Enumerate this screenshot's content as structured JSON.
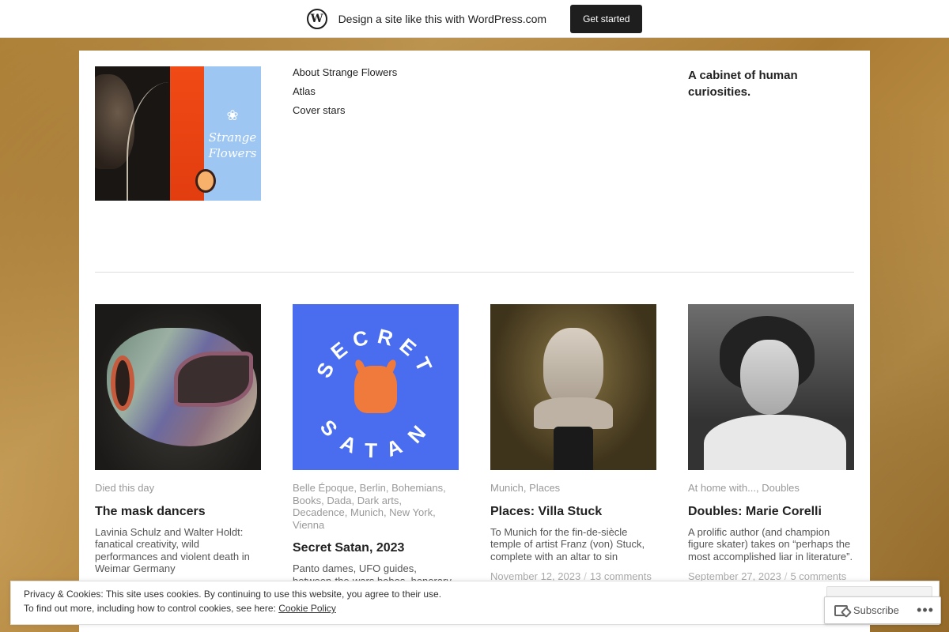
{
  "wpbar": {
    "text": "Design a site like this with WordPress.com",
    "button": "Get started",
    "logo_icon": "wordpress-logo-icon"
  },
  "header": {
    "logo_text_1": "Strange",
    "logo_text_2": "Flowers",
    "nav": [
      "About Strange Flowers",
      "Atlas",
      "Cover stars"
    ],
    "tagline": "A cabinet of human curiosities."
  },
  "posts": [
    {
      "categories": [
        "Died this day"
      ],
      "title": "The mask dancers",
      "excerpt": "Lavinia Schulz and Walter Holdt: fanatical creativity, wild performances and violent death in Weimar Germany",
      "date": "",
      "comments": ""
    },
    {
      "categories": [
        "Belle Époque",
        "Berlin",
        "Bohemians",
        "Books",
        "Dada",
        "Dark arts",
        "Decadence",
        "Munich",
        "New York",
        "Vienna"
      ],
      "title": "Secret Satan, 2023",
      "excerpt": "Panto dames, UFO guides, between-the-wars bobos, honorary ... our annual book round-up!",
      "image_text_top": "SECRET",
      "image_text_bottom": "SATAN"
    },
    {
      "categories": [
        "Munich",
        "Places"
      ],
      "title": "Places: Villa Stuck",
      "excerpt": "To Munich for the fin-de-siècle temple of artist Franz (von) Stuck, complete with an altar to sin",
      "date": "November 12, 2023",
      "comments": "13 comments"
    },
    {
      "categories": [
        "At home with...",
        "Doubles"
      ],
      "title": "Doubles: Marie Corelli",
      "excerpt": "A prolific author (and champion figure skater) takes on “perhaps the most accomplished liar in literature”.",
      "date": "September 27, 2023",
      "comments": "5 comments"
    }
  ],
  "cookie": {
    "line1": "Privacy & Cookies: This site uses cookies. By continuing to use this website, you agree to their use.",
    "line2_prefix": "To find out more, including how to control cookies, see here: ",
    "policy_link": "Cookie Policy"
  },
  "subscribe": {
    "label": "Subscribe",
    "more": "•••"
  }
}
